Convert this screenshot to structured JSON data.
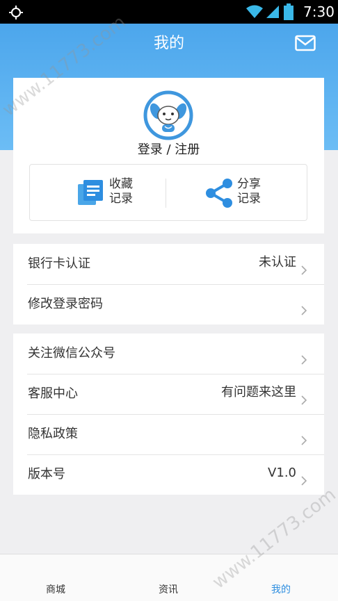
{
  "status_bar": {
    "time": "7:30"
  },
  "header": {
    "title": "我的",
    "mail_icon": "mail-icon"
  },
  "profile": {
    "avatar_icon": "rabbit-avatar-icon",
    "login_label": "登录 / 注册",
    "quick_actions": [
      {
        "label_line1": "收藏",
        "label_line2": "记录",
        "icon": "document-list-icon"
      },
      {
        "label_line1": "分享",
        "label_line2": "记录",
        "icon": "share-icon"
      }
    ]
  },
  "groups": [
    [
      {
        "label": "银行卡认证",
        "value": "未认证"
      },
      {
        "label": "修改登录密码",
        "value": ""
      }
    ],
    [
      {
        "label": "关注微信公众号",
        "value": ""
      },
      {
        "label": "客服中心",
        "value": "有问题来这里"
      },
      {
        "label": "隐私政策",
        "value": ""
      },
      {
        "label": "版本号",
        "value": "V1.0"
      }
    ]
  ],
  "bottom_nav": [
    {
      "label": "商城",
      "active": false
    },
    {
      "label": "资讯",
      "active": false
    },
    {
      "label": "我的",
      "active": true
    }
  ],
  "watermark": "www.11773.com",
  "colors": {
    "header": "#4ca6ec",
    "accent": "#2e8ee0",
    "background": "#efeff1"
  }
}
